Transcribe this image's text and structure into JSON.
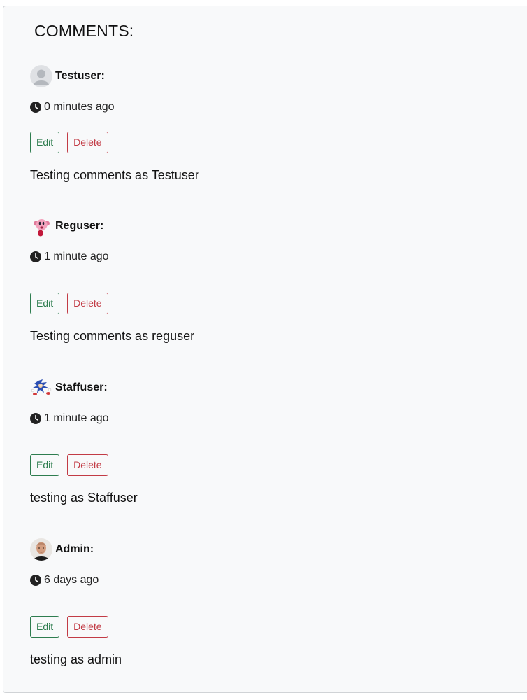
{
  "section": {
    "title": "COMMENTS:"
  },
  "comments": [
    {
      "author": "Testuser:",
      "time": "0 minutes ago",
      "edit_label": "Edit",
      "delete_label": "Delete",
      "body": "Testing comments as Testuser",
      "avatar_icon": "default-user-avatar-icon"
    },
    {
      "author": "Reguser:",
      "time": "1 minute ago",
      "edit_label": "Edit",
      "delete_label": "Delete",
      "body": "Testing comments as reguser",
      "avatar_icon": "pink-character-avatar-icon"
    },
    {
      "author": "Staffuser:",
      "time": "1 minute ago",
      "edit_label": "Edit",
      "delete_label": "Delete",
      "body": "testing as Staffuser",
      "avatar_icon": "blue-character-avatar-icon"
    },
    {
      "author": "Admin:",
      "time": "6 days ago",
      "edit_label": "Edit",
      "delete_label": "Delete",
      "body": "testing as admin",
      "avatar_icon": "photo-avatar-icon"
    }
  ],
  "colors": {
    "panel_bg": "#f8f9fa",
    "edit": "#2e7d4f",
    "delete": "#c23b45"
  }
}
